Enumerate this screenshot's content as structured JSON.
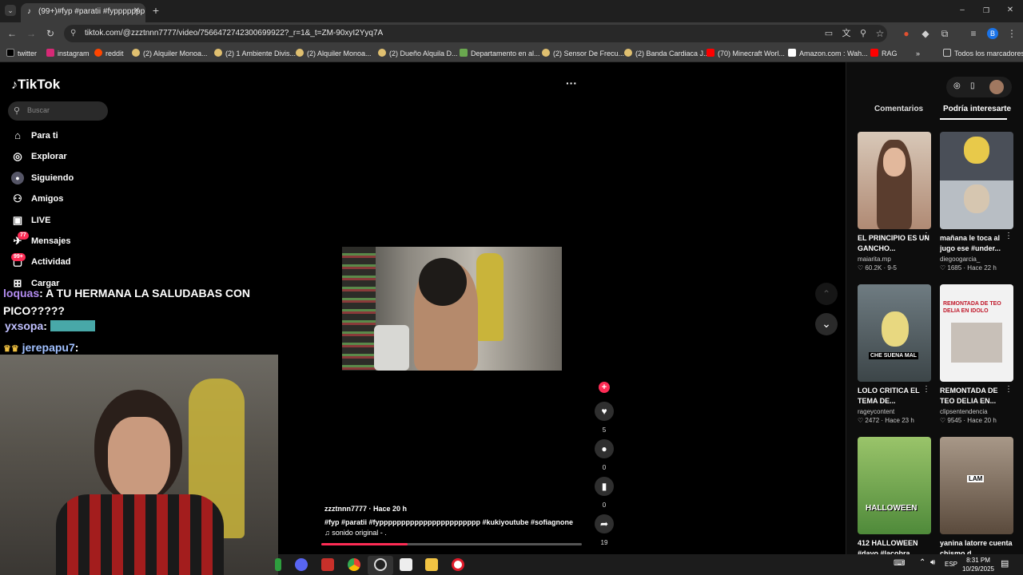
{
  "browser": {
    "tab_title": "(99+)#fyp #paratii #fyppppppp",
    "url": "tiktok.com/@zzztnnn7777/video/7566472742300699922?_r=1&_t=ZM-90xyI2Yyq7A",
    "profile_letter": "B",
    "bookmarks": [
      {
        "label": "twitter",
        "color": "#000000"
      },
      {
        "label": "instagram",
        "color": "#d62976"
      },
      {
        "label": "reddit",
        "color": "#ff4500"
      },
      {
        "label": "(2) Alquiler Monoa...",
        "color": "#e0c070"
      },
      {
        "label": "(2) 1 Ambiente Divis...",
        "color": "#e0c070"
      },
      {
        "label": "(2) Alquiler Monoa...",
        "color": "#e0c070"
      },
      {
        "label": "(2) Dueño Alquila D...",
        "color": "#e0c070"
      },
      {
        "label": "Departamento en al...",
        "color": "#6aa84f"
      },
      {
        "label": "(2) Sensor De Frecu...",
        "color": "#e0c070"
      },
      {
        "label": "(2) Banda Cardiaca J...",
        "color": "#e0c070"
      },
      {
        "label": "(70) Minecraft Worl...",
        "color": "#ff0000"
      },
      {
        "label": "Amazon.com : Wah...",
        "color": "#ffffff"
      },
      {
        "label": "RAG",
        "color": "#ff0000"
      }
    ],
    "all_bookmarks": "Todos los marcadores"
  },
  "tiktok": {
    "logo": "TikTok",
    "search_placeholder": "Buscar",
    "nav": [
      {
        "label": "Para ti",
        "icon": "home-icon"
      },
      {
        "label": "Explorar",
        "icon": "compass-icon"
      },
      {
        "label": "Siguiendo",
        "icon": "following-icon"
      },
      {
        "label": "Amigos",
        "icon": "friends-icon"
      },
      {
        "label": "LIVE",
        "icon": "live-icon"
      },
      {
        "label": "Mensajes",
        "icon": "messages-icon",
        "badge": "77"
      },
      {
        "label": "Actividad",
        "icon": "activity-icon",
        "badge": "99+"
      },
      {
        "label": "Cargar",
        "icon": "upload-icon"
      }
    ],
    "more_menu": "···",
    "video": {
      "author": "zzztnnn7777 · Hace 20 h",
      "hashtags": "#fyp #paratii #fyppppppppppppppppppppppp #kukiyoutube #sofiagnone",
      "sound": "♫ sonido original - .",
      "progress": 0.33
    },
    "actions": {
      "likes": "5",
      "comments": "0",
      "saves": "0",
      "shares": "19"
    },
    "tabs": [
      "Comentarios",
      "Podría interesarte"
    ],
    "active_tab": 1,
    "suggestions": [
      {
        "title": "EL PRINCIPIO ES UN GANCHO...",
        "author": "maiarita.mp",
        "stats": "♡ 60.2K · 9-5",
        "color": "#c9a68a"
      },
      {
        "title": "mañana le toca al jugo ese #under...",
        "author": "diegoogarcia_",
        "stats": "♡ 1685 · Hace 22 h",
        "color": "#8a8f95"
      },
      {
        "title": "LOLO CRITICA EL TEMA DE...",
        "author": "rageycontent",
        "stats": "♡ 2472 · Hace 23 h",
        "color": "#5d6b72",
        "overlay": "CHE SUENA MAL"
      },
      {
        "title": "REMONTADA DE TEO DELIA EN...",
        "author": "clipsentendencia",
        "stats": "♡ 9545 · Hace 20 h",
        "color": "#e8e8e8",
        "overlay": "REMONTADA DE TEO DELIA EN IDOLO"
      },
      {
        "title": "412 HALLOWEEN #dayo #lacobra...",
        "author": "",
        "stats": "",
        "color": "#4f8a3a",
        "overlay": "HALLOWEEN"
      },
      {
        "title": "yanina latorre cuenta chismo d...",
        "author": "",
        "stats": "",
        "color": "#7a6a5a",
        "overlay": "LAM"
      }
    ]
  },
  "stream_overlay": {
    "chat": [
      {
        "user": "loquas",
        "text": ": A TU HERMANA LA SALUDABAS CON PICO?????"
      },
      {
        "user": "yxsopa",
        "text": ":"
      },
      {
        "user": "jerepapu7",
        "text": ":"
      }
    ]
  },
  "taskbar": {
    "lang": "ESP",
    "time": "8:31 PM",
    "date": "10/29/2025"
  }
}
